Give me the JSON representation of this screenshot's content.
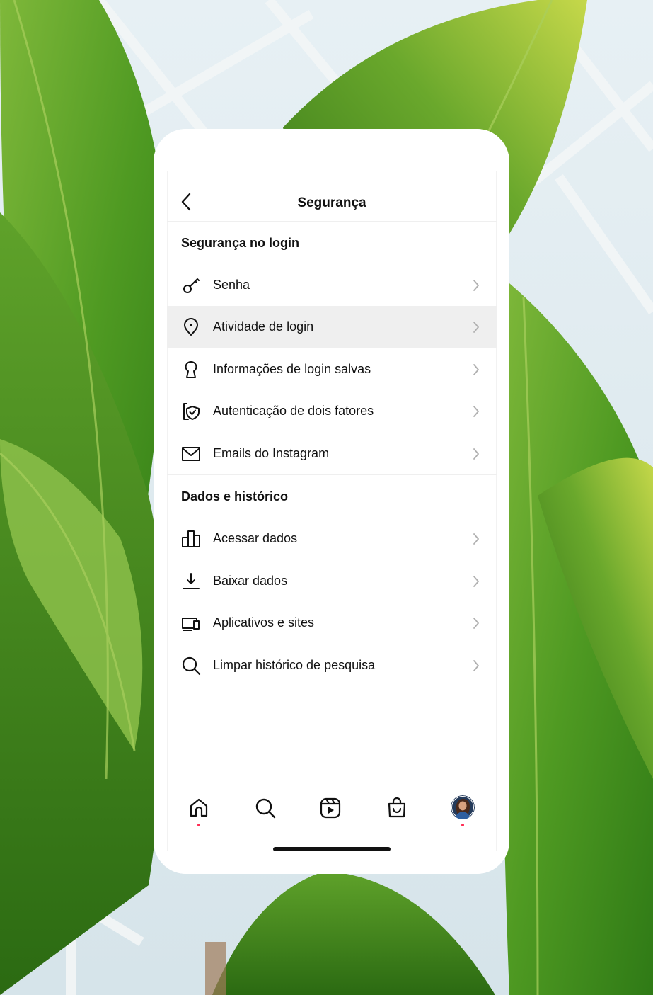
{
  "colors": {
    "accent_dot": "#ff2d55",
    "row_highlight": "#efefef",
    "text": "#111111",
    "chevron": "#b0b0b0"
  },
  "header": {
    "title": "Segurança",
    "back_icon": "chevron-left-icon"
  },
  "sections": [
    {
      "title": "Segurança no login",
      "items": [
        {
          "label": "Senha",
          "icon": "key-icon"
        },
        {
          "label": "Atividade de login",
          "icon": "location-pin-icon",
          "highlighted": true
        },
        {
          "label": "Informações de login salvas",
          "icon": "keyhole-icon"
        },
        {
          "label": "Autenticação de dois fatores",
          "icon": "shield-check-icon"
        },
        {
          "label": "Emails do Instagram",
          "icon": "mail-icon"
        }
      ]
    },
    {
      "title": "Dados e histórico",
      "items": [
        {
          "label": "Acessar dados",
          "icon": "bar-chart-icon"
        },
        {
          "label": "Baixar dados",
          "icon": "download-icon"
        },
        {
          "label": "Aplicativos e sites",
          "icon": "devices-icon"
        },
        {
          "label": "Limpar histórico de pesquisa",
          "icon": "search-icon"
        }
      ]
    }
  ],
  "tabbar": [
    {
      "name": "home",
      "icon": "home-icon",
      "badge": true
    },
    {
      "name": "search",
      "icon": "search-icon",
      "badge": false
    },
    {
      "name": "reels",
      "icon": "reels-icon",
      "badge": false
    },
    {
      "name": "shop",
      "icon": "shopping-bag-icon",
      "badge": false
    },
    {
      "name": "profile",
      "icon": "avatar-icon",
      "badge": true
    }
  ]
}
